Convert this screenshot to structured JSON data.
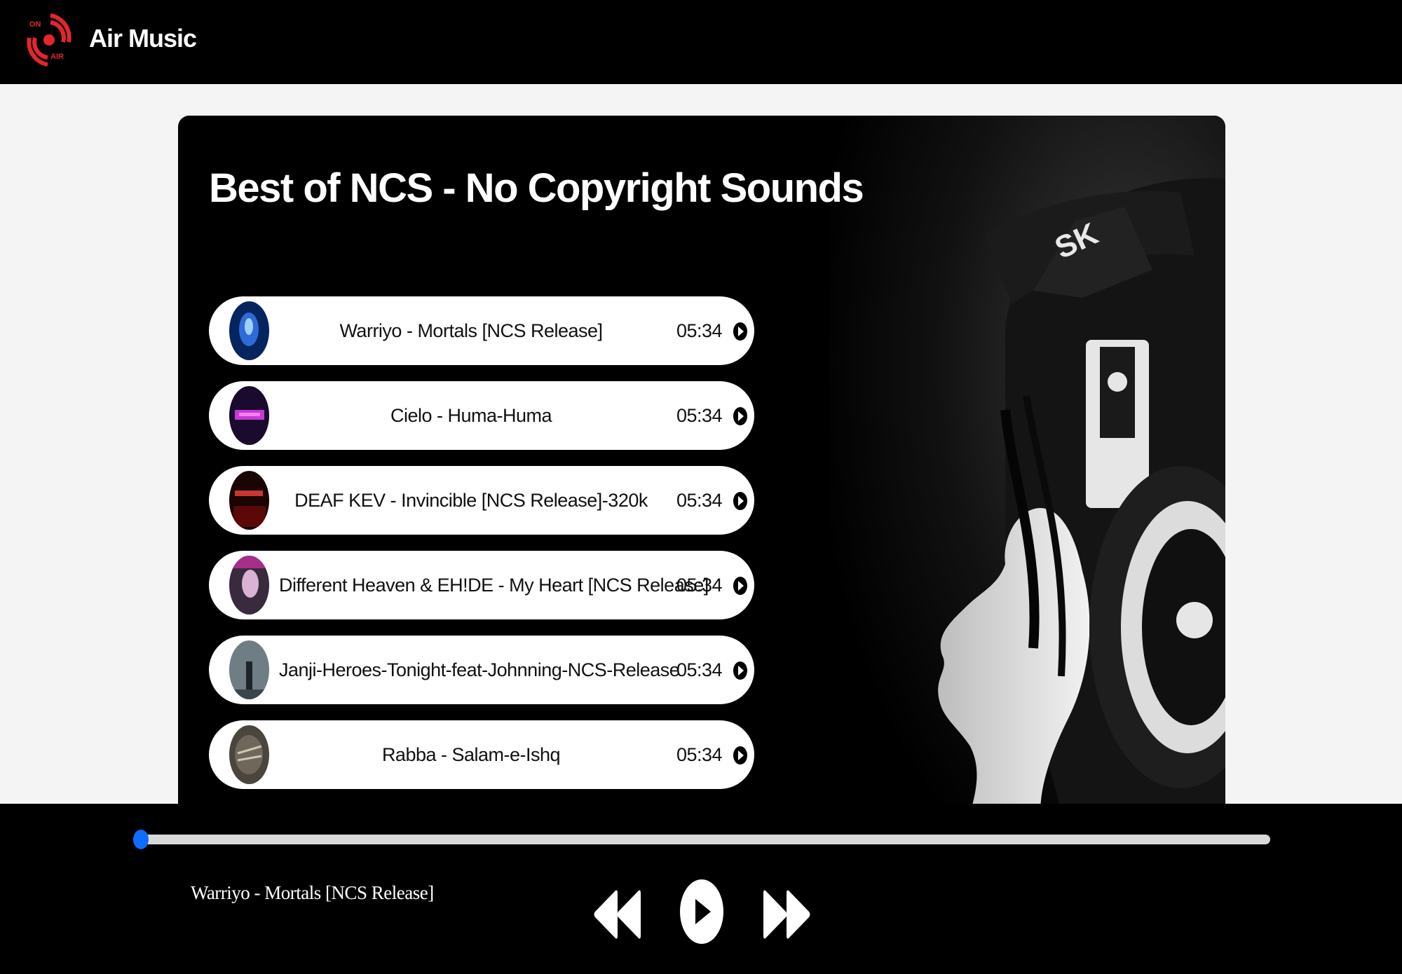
{
  "app": {
    "name": "Air Music",
    "logo_text_top": "ON",
    "logo_text_bottom": "AIR"
  },
  "playlist": {
    "title": "Best of NCS - No Copyright Sounds",
    "tracks": [
      {
        "name": "Warriyo - Mortals [NCS Release]",
        "duration": "05:34"
      },
      {
        "name": "Cielo - Huma-Huma",
        "duration": "05:34"
      },
      {
        "name": "DEAF KEV - Invincible [NCS Release]-320k",
        "duration": "05:34"
      },
      {
        "name": "Different Heaven & EH!DE - My Heart [NCS Release]",
        "duration": "05:34"
      },
      {
        "name": "Janji-Heroes-Tonight-feat-Johnning-NCS-Release",
        "duration": "05:34"
      },
      {
        "name": "Rabba - Salam-e-Ishq",
        "duration": "05:34"
      }
    ]
  },
  "player": {
    "now_playing": "Warriyo - Mortals [NCS Release]",
    "progress": 0
  },
  "colors": {
    "accent": "#0d6efd",
    "brand_red": "#e3262b",
    "nav_bg": "#000000",
    "page_bg": "#f4f4f4"
  },
  "icons": {
    "logo": "on-air-broadcast-icon",
    "track_play": "play-circle-icon",
    "previous": "backward-icon",
    "play": "play-circle-icon",
    "next": "forward-icon"
  }
}
